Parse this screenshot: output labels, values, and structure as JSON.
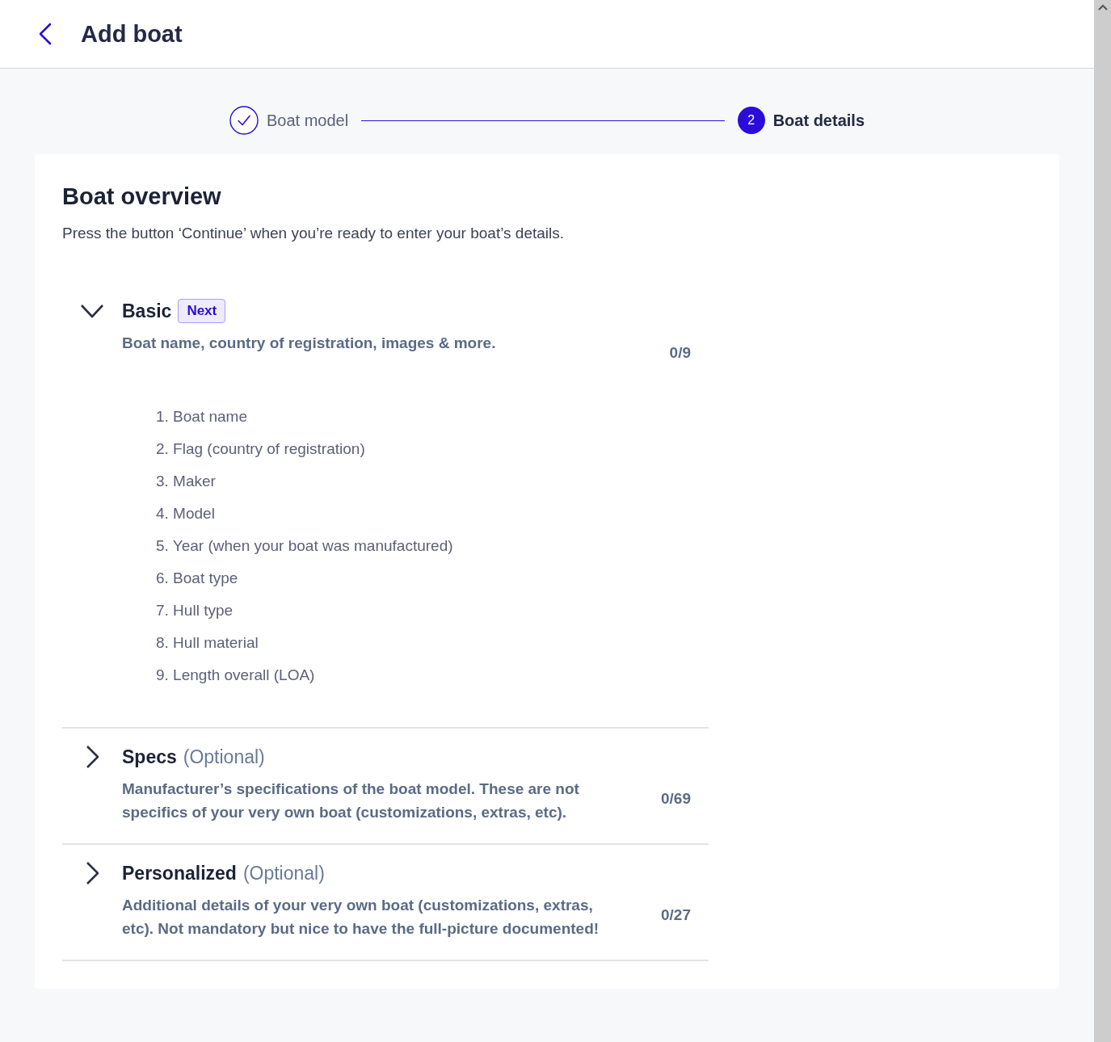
{
  "header": {
    "title": "Add boat"
  },
  "steps": [
    {
      "kind": "done",
      "label": "Boat model",
      "selected": false
    },
    {
      "kind": "current",
      "number": "2",
      "label": "Boat details",
      "selected": true
    }
  ],
  "overview": {
    "title": "Boat overview",
    "description": "Press the button ‘Continue’ when you’re ready to enter your boat’s details."
  },
  "sections": [
    {
      "title": "Basic",
      "badge": "Next",
      "expanded": true,
      "description": "Boat name, country of registration, images & more.",
      "count": "0/9",
      "items": [
        "1. Boat name",
        "2. Flag (country of registration)",
        "3. Maker",
        "4. Model",
        "5. Year (when your boat was manufactured)",
        "6. Boat type",
        "7. Hull type",
        "8. Hull material",
        "9. Length overall (LOA)"
      ]
    },
    {
      "title": "Specs",
      "optional": "(Optional)",
      "expanded": false,
      "description": "Manufacturer’s specifications of the boat model. These are not specifics of your very own boat (customizations, extras, etc).",
      "count": "0/69"
    },
    {
      "title": "Personalized",
      "optional": "(Optional)",
      "expanded": false,
      "description": "Additional details of your very own boat (customizations, extras, etc). Not mandatory but nice to have the full-picture documented!",
      "count": "0/27"
    }
  ]
}
